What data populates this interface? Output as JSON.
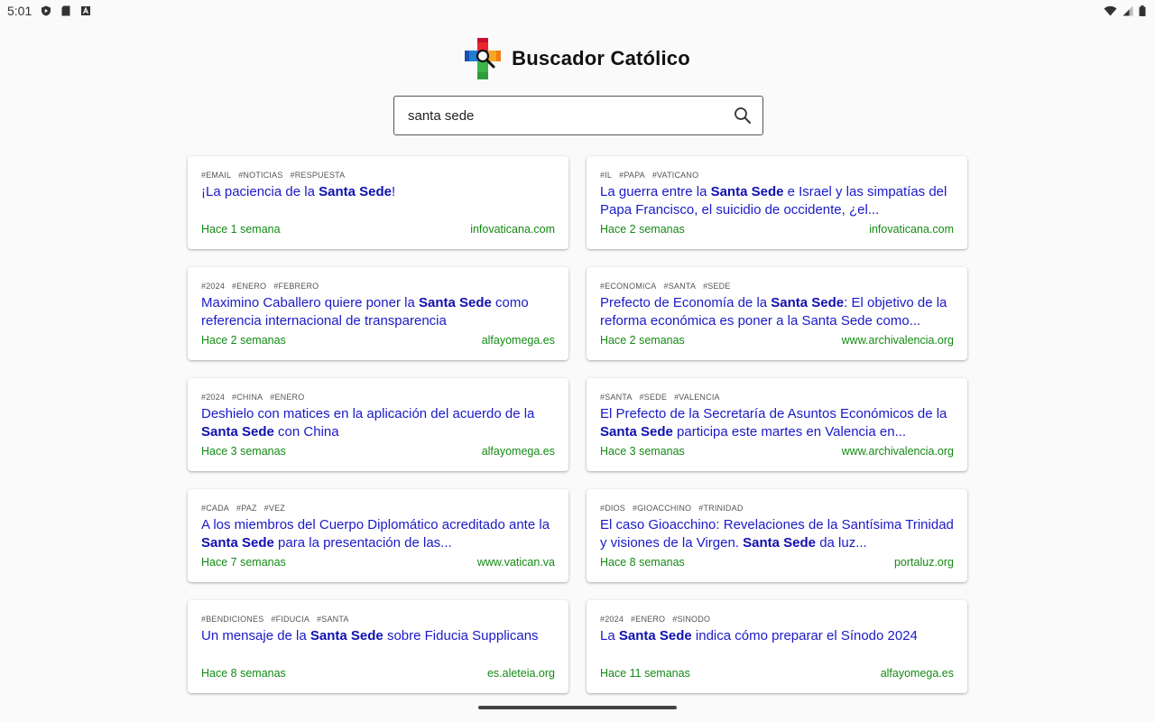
{
  "status_bar": {
    "time": "5:01"
  },
  "app": {
    "title": "Buscador Católico"
  },
  "search": {
    "value": "santa sede",
    "placeholder": ""
  },
  "results": [
    {
      "tags": [
        "#email",
        "#noticias",
        "#respuesta"
      ],
      "title_before": "¡La paciencia de la ",
      "title_highlight": "Santa Sede",
      "title_after": "!",
      "time": "Hace 1 semana",
      "source": "infovaticana.com"
    },
    {
      "tags": [
        "#il",
        "#papa",
        "#vaticano"
      ],
      "title_before": "La guerra entre la ",
      "title_highlight": "Santa Sede",
      "title_after": " e Israel y las simpatías del Papa Francisco, el suicidio de occidente, ¿el...",
      "time": "Hace 2 semanas",
      "source": "infovaticana.com"
    },
    {
      "tags": [
        "#2024",
        "#enero",
        "#febrero"
      ],
      "title_before": "Maximino Caballero quiere poner la ",
      "title_highlight": "Santa Sede",
      "title_after": " como referencia internacional de transparencia",
      "time": "Hace 2 semanas",
      "source": "alfayomega.es"
    },
    {
      "tags": [
        "#economica",
        "#santa",
        "#sede"
      ],
      "title_before": "Prefecto de Economía de la ",
      "title_highlight": "Santa Sede",
      "title_after": ": El objetivo de la reforma económica es poner a la Santa Sede como...",
      "time": "Hace 2 semanas",
      "source": "www.archivalencia.org"
    },
    {
      "tags": [
        "#2024",
        "#china",
        "#enero"
      ],
      "title_before": "Deshielo con matices en la aplicación del acuerdo de la ",
      "title_highlight": "Santa Sede",
      "title_after": " con China",
      "time": "Hace 3 semanas",
      "source": "alfayomega.es"
    },
    {
      "tags": [
        "#santa",
        "#sede",
        "#valencia"
      ],
      "title_before": "El Prefecto de la Secretaría de Asuntos Económicos de la ",
      "title_highlight": "Santa Sede",
      "title_after": " participa este martes en Valencia en...",
      "time": "Hace 3 semanas",
      "source": "www.archivalencia.org"
    },
    {
      "tags": [
        "#cada",
        "#paz",
        "#vez"
      ],
      "title_before": "A los miembros del Cuerpo Diplomático acreditado ante la ",
      "title_highlight": "Santa Sede",
      "title_after": " para la presentación de las...",
      "time": "Hace 7 semanas",
      "source": "www.vatican.va"
    },
    {
      "tags": [
        "#dios",
        "#gioacchino",
        "#trinidad"
      ],
      "title_before": "El caso Gioacchino: Revelaciones de la Santísima Trinidad y visiones de la Virgen. ",
      "title_highlight": "Santa Sede",
      "title_after": " da luz...",
      "time": "Hace 8 semanas",
      "source": "portaluz.org"
    },
    {
      "tags": [
        "#bendiciones",
        "#fiducia",
        "#santa"
      ],
      "title_before": "Un mensaje de la ",
      "title_highlight": "Santa Sede",
      "title_after": " sobre Fiducia Supplicans",
      "time": "Hace 8 semanas",
      "source": "es.aleteia.org"
    },
    {
      "tags": [
        "#2024",
        "#enero",
        "#sinodo"
      ],
      "title_before": "La ",
      "title_highlight": "Santa Sede",
      "title_after": " indica cómo preparar el Sínodo 2024",
      "time": "Hace 11 semanas",
      "source": "alfayomega.es"
    }
  ],
  "icons": {
    "status_left": [
      "shield-play-icon",
      "sd-card-icon",
      "font-a-icon"
    ],
    "status_right": [
      "wifi-icon",
      "signal-icon",
      "battery-icon"
    ],
    "logo": "cross-magnifier-logo",
    "search": "search-icon"
  },
  "colors": {
    "title_link": "#1a1ac8",
    "meta_green": "#148a14",
    "tag_gray": "#555555"
  }
}
